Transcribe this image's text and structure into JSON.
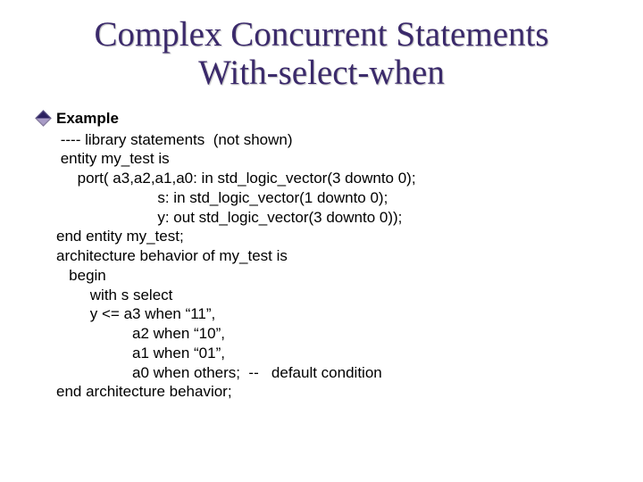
{
  "title": {
    "line1": "Complex Concurrent Statements",
    "line2": "With-select-when"
  },
  "bullet": {
    "label": "Example"
  },
  "code": {
    "l01": " ---- library statements  (not shown)",
    "l02": " entity my_test is",
    "l03": "     port( a3,a2,a1,a0: in std_logic_vector(3 downto 0);",
    "l04": "                        s: in std_logic_vector(1 downto 0);",
    "l05": "                        y: out std_logic_vector(3 downto 0));",
    "l06": "end entity my_test;",
    "l07": "architecture behavior of my_test is",
    "l08": "   begin",
    "l09": "        with s select",
    "l10": "        y <= a3 when “11”,",
    "l11": "                  a2 when “10”,",
    "l12": "                  a1 when “01”,",
    "l13": "                  a0 when others;  --   default condition",
    "l14": "end architecture behavior;"
  }
}
